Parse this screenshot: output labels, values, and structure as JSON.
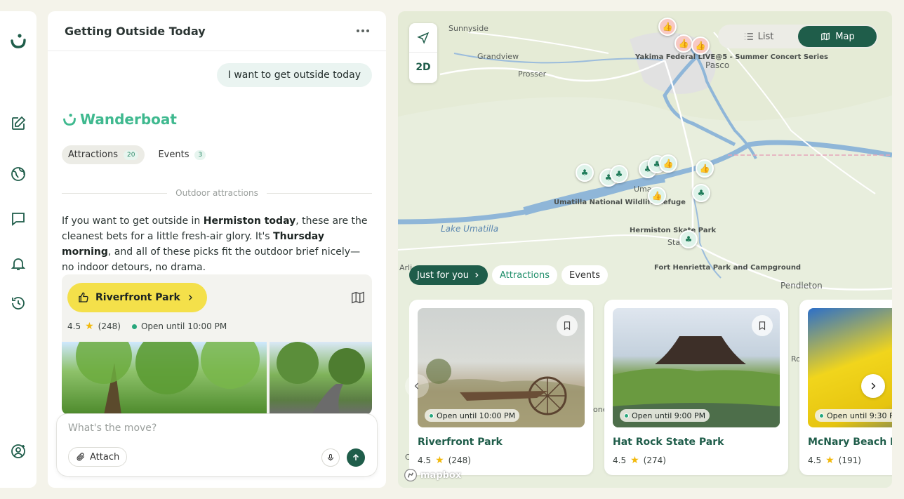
{
  "rail": {
    "icons": [
      "logo-icon",
      "new-chat-icon",
      "explore-icon",
      "messages-icon",
      "notifications-icon",
      "history-icon",
      "account-icon"
    ]
  },
  "chat": {
    "title": "Getting Outside Today",
    "user_message": "I want to get outside today",
    "brand": "Wanderboat",
    "tabs": [
      {
        "label": "Attractions",
        "count": "20"
      },
      {
        "label": "Events",
        "count": "3"
      }
    ],
    "section_title": "Outdoor attractions",
    "intro": {
      "p1": "If you want to get outside in ",
      "b1": "Hermiston today",
      "p2": ", these are the cleanest bets for a little fresh-air glory. It's ",
      "b2": "Thursday morning",
      "p3": ", and all of these picks fit the outdoor brief nicely—no indoor detours, no drama."
    },
    "place": {
      "name": "Riverfront Park",
      "rating": "4.5",
      "reviews": "(248)",
      "hours": "Open until 10:00 PM"
    },
    "composer": {
      "placeholder": "What's the move?",
      "attach_label": "Attach"
    }
  },
  "map": {
    "ctrl_2d": "2D",
    "view_toggle": {
      "list": "List",
      "map": "Map"
    },
    "labels": {
      "sunnyside": "Sunnyside",
      "grandview": "Grandview",
      "prosser": "Prosser",
      "pasco": "Pasco",
      "lake": "Lake Umatilla",
      "pendleton": "Pendleton",
      "yakima": "Yakima Federal LIVE@5 - Summer Concert Series",
      "umatilla_refuge": "Umatilla National Wildlife Refuge",
      "hermiston_skate": "Hermiston Skate Park",
      "fort": "Fort Henrietta Park and Campground",
      "stanfield": "Stanfi",
      "umatilla": "Uma",
      "arlington": "Arli",
      "ro": "Ro",
      "one": "one",
      "c": "C"
    },
    "filters": {
      "just_for_you": "Just for you",
      "attractions": "Attractions",
      "events": "Events"
    },
    "cards": [
      {
        "name": "Riverfront Park",
        "rating": "4.5",
        "reviews": "(248)",
        "hours": "Open until 10:00 PM"
      },
      {
        "name": "Hat Rock State Park",
        "rating": "4.5",
        "reviews": "(274)",
        "hours": "Open until 9:00 PM"
      },
      {
        "name": "McNary Beach R",
        "rating": "4.5",
        "reviews": "(191)",
        "hours": "Open until 9:30 P"
      }
    ],
    "attribution": "mapbox"
  },
  "colors": {
    "brand_green": "#1f5d4a",
    "accent_mint": "#3fb98f",
    "highlight_yellow": "#f4e04a",
    "star": "#f2b90c"
  }
}
